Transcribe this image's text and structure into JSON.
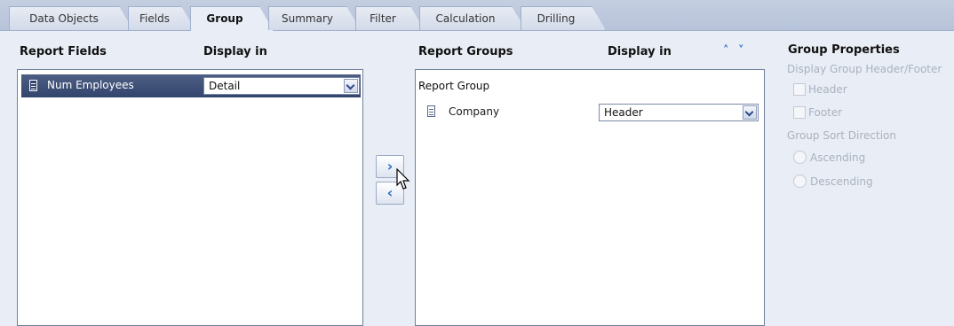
{
  "tabs": [
    {
      "label": "Data Objects",
      "active": false
    },
    {
      "label": "Fields",
      "active": false
    },
    {
      "label": "Group",
      "active": true
    },
    {
      "label": "Summary",
      "active": false
    },
    {
      "label": "Filter",
      "active": false
    },
    {
      "label": "Calculation",
      "active": false
    },
    {
      "label": "Drilling",
      "active": false
    }
  ],
  "left": {
    "header_fields": "Report Fields",
    "header_display": "Display in",
    "rows": [
      {
        "label": "Num Employees",
        "display": "Detail",
        "selected": true,
        "icon": "field-icon"
      }
    ]
  },
  "middle": {
    "move_right": "arrow-right-icon",
    "move_left": "arrow-left-icon"
  },
  "right": {
    "header_groups": "Report Groups",
    "header_display": "Display in",
    "group_root": "Report Group",
    "rows": [
      {
        "label": "Company",
        "display": "Header",
        "icon": "field-icon"
      }
    ],
    "sort_icons": [
      "move-up-icon",
      "move-down-icon"
    ]
  },
  "properties": {
    "title": "Group Properties",
    "header_footer_label": "Display Group Header/Footer",
    "header_option": "Header",
    "footer_option": "Footer",
    "sort_label": "Group Sort Direction",
    "ascending": "Ascending",
    "descending": "Descending"
  },
  "colors": {
    "selected_row": "#33456d",
    "accent_blue": "#2f6bc9",
    "disabled_text": "#a9b1bd"
  }
}
